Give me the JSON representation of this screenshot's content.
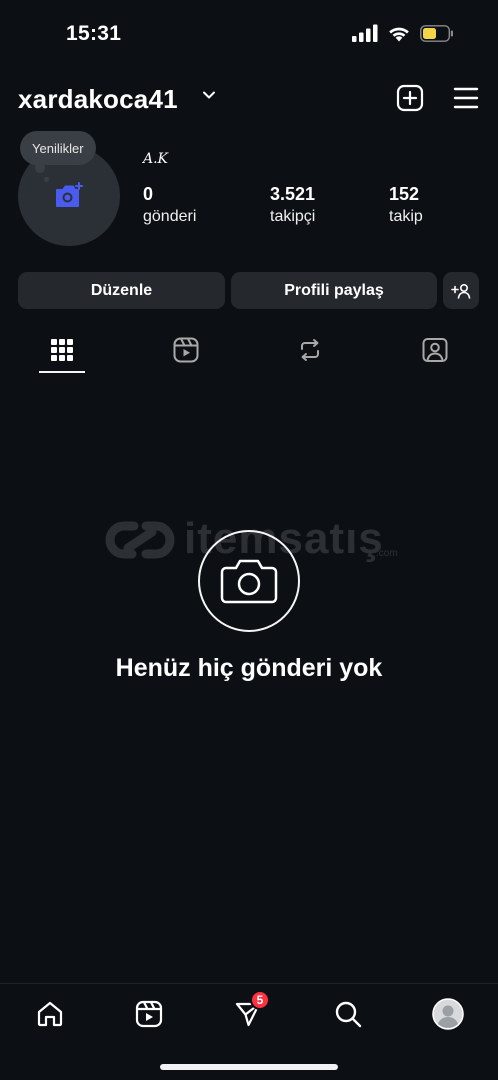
{
  "status_bar": {
    "time": "15:31",
    "battery_color": "#f5d547"
  },
  "header": {
    "username": "xardakoca41"
  },
  "profile": {
    "notes_bubble": "Yenilikler",
    "display_name": "A.K",
    "stats": [
      {
        "value": "0",
        "label": "gönderi"
      },
      {
        "value": "3.521",
        "label": "takipçi"
      },
      {
        "value": "152",
        "label": "takip"
      }
    ]
  },
  "actions": {
    "edit_label": "Düzenle",
    "share_label": "Profili paylaş"
  },
  "tabs": [
    "grid-icon",
    "reels-icon",
    "reposts-icon",
    "tagged-icon"
  ],
  "empty_state": {
    "text": "Henüz hiç gönderi yok"
  },
  "watermark": {
    "text": "itemsatış",
    "suffix": ".com"
  },
  "bottom_nav": {
    "items": [
      "home-icon",
      "reels-icon",
      "messages-icon",
      "search-icon",
      "profile-avatar"
    ],
    "messages_badge": "5"
  },
  "colors": {
    "background": "#0c1014",
    "button": "#25292e",
    "accent_blue": "#4a5cf0",
    "badge": "#ff3040"
  }
}
